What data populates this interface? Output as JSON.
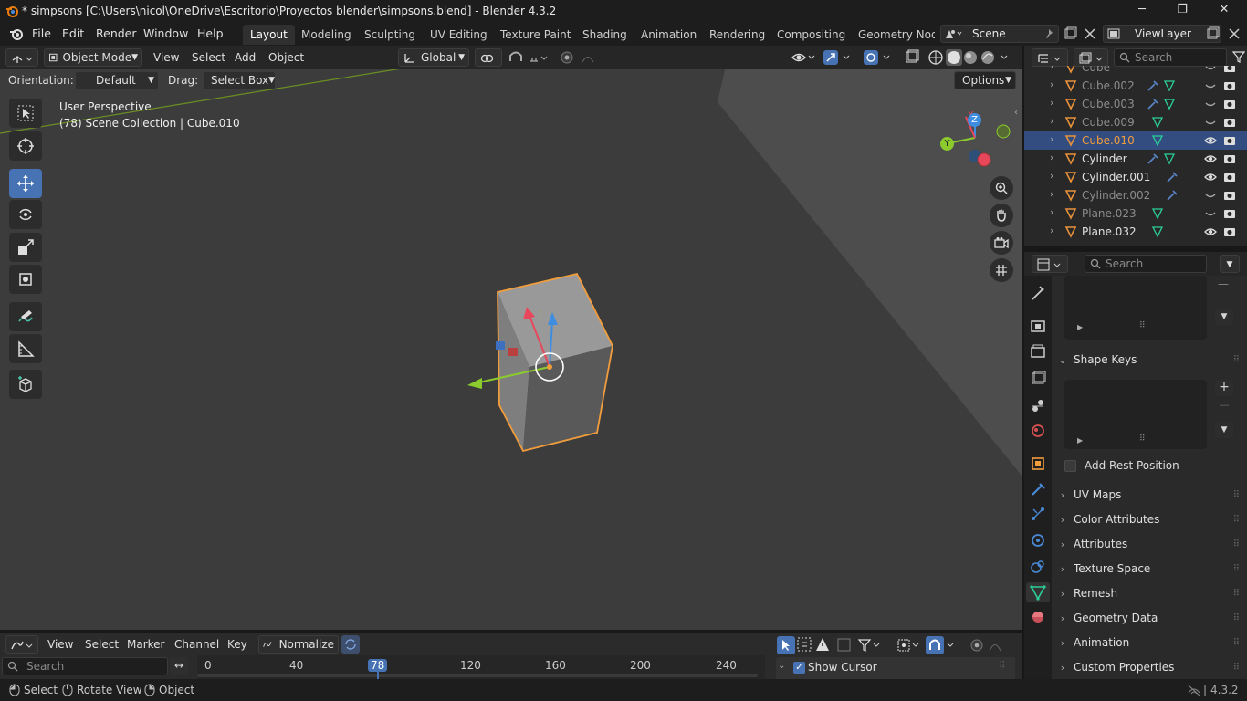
{
  "window": {
    "title": "* simpsons [C:\\Users\\nicol\\OneDrive\\Escritorio\\Proyectos blender\\simpsons.blend] - Blender 4.3.2",
    "minimize": "─",
    "maximize": "❐",
    "close": "✕"
  },
  "menus": [
    "File",
    "Edit",
    "Render",
    "Window",
    "Help"
  ],
  "workspaces": [
    "Layout",
    "Modeling",
    "Sculpting",
    "UV Editing",
    "Texture Paint",
    "Shading",
    "Animation",
    "Rendering",
    "Compositing",
    "Geometry Node"
  ],
  "scene": {
    "name": "Scene",
    "view_layer": "ViewLayer"
  },
  "viewport_header": {
    "mode": "Object Mode",
    "menus": [
      "View",
      "Select",
      "Add",
      "Object"
    ],
    "transform": "Global",
    "orientation_label": "Orientation:",
    "orientation_value": "Default",
    "drag_label": "Drag:",
    "drag_value": "Select Box",
    "options": "Options"
  },
  "viewport": {
    "perspective": "User Perspective",
    "collection": "(78) Scene Collection | Cube.010",
    "gizmo": {
      "x": "X",
      "y": "Y",
      "z": "Z"
    }
  },
  "outliner": {
    "search_placeholder": "Search",
    "rows": [
      {
        "name": "Cube",
        "dim": true,
        "selected": false,
        "modifier": false,
        "mesh": false
      },
      {
        "name": "Cube.002",
        "dim": true,
        "selected": false,
        "modifier": true,
        "mesh": true
      },
      {
        "name": "Cube.003",
        "dim": true,
        "selected": false,
        "modifier": true,
        "mesh": true
      },
      {
        "name": "Cube.009",
        "dim": true,
        "selected": false,
        "modifier": false,
        "mesh": true
      },
      {
        "name": "Cube.010",
        "dim": false,
        "selected": true,
        "modifier": false,
        "mesh": true
      },
      {
        "name": "Cylinder",
        "dim": false,
        "selected": false,
        "modifier": true,
        "mesh": true
      },
      {
        "name": "Cylinder.001",
        "dim": false,
        "selected": false,
        "modifier": true,
        "mesh": false
      },
      {
        "name": "Cylinder.002",
        "dim": true,
        "selected": false,
        "modifier": true,
        "mesh": false
      },
      {
        "name": "Plane.023",
        "dim": true,
        "selected": false,
        "modifier": false,
        "mesh": true
      },
      {
        "name": "Plane.032",
        "dim": false,
        "selected": false,
        "modifier": false,
        "mesh": true
      }
    ]
  },
  "properties": {
    "search_placeholder": "Search",
    "shape_keys": "Shape Keys",
    "add_rest_position": "Add Rest Position",
    "panels": [
      "UV Maps",
      "Color Attributes",
      "Attributes",
      "Texture Space",
      "Remesh",
      "Geometry Data",
      "Animation",
      "Custom Properties"
    ]
  },
  "timeline": {
    "menus": [
      "View",
      "Select",
      "Marker",
      "Channel",
      "Key"
    ],
    "normalize": "Normalize",
    "search_placeholder": "Search",
    "frames": [
      "0",
      "40",
      "78",
      "120",
      "160",
      "200",
      "240"
    ],
    "current_frame": "78",
    "show_cursor": "Show Cursor"
  },
  "statusbar": {
    "items": [
      "Select",
      "Rotate View",
      "Object"
    ],
    "version": "4.3.2"
  },
  "colors": {
    "accent": "#4772b3",
    "selection_orange": "#f29d3c",
    "axis_x": "#e8475b",
    "axis_y": "#8ccb2e",
    "axis_z": "#3f8de0"
  }
}
